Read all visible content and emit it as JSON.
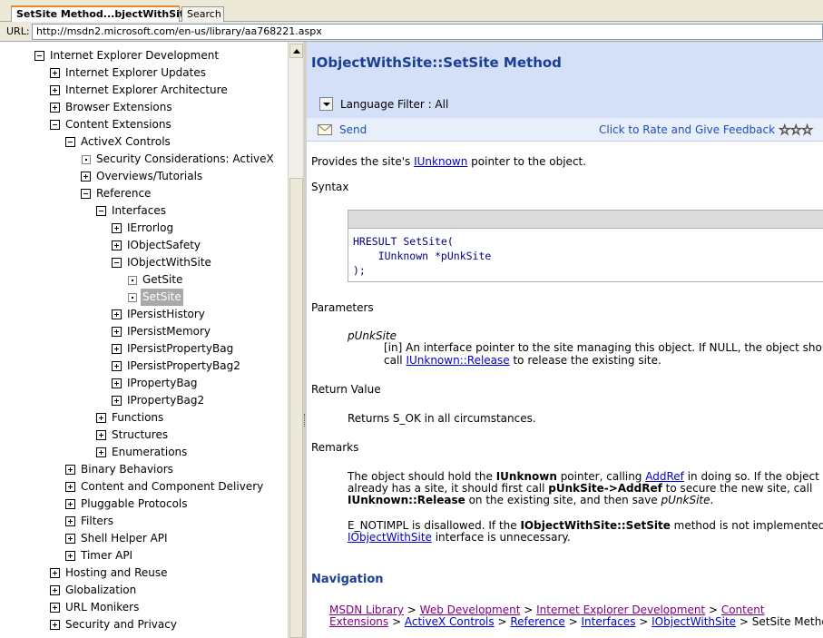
{
  "tabs": {
    "active": "SetSite Method...bjectWithSite)",
    "search": "Search"
  },
  "url": {
    "label": "URL:",
    "value": "http://msdn2.microsoft.com/en-us/library/aa768221.aspx"
  },
  "toc": {
    "ied": "Internet Explorer Development",
    "updates": "Internet Explorer Updates",
    "architecture": "Internet Explorer Architecture",
    "browser_ext": "Browser Extensions",
    "content_ext": "Content Extensions",
    "activex": "ActiveX Controls",
    "security_activex": "Security Considerations: ActiveX",
    "overviews": "Overviews/Tutorials",
    "reference": "Reference",
    "interfaces": "Interfaces",
    "ierrorlog": "IErrorlog",
    "iobjectsafety": "IObjectSafety",
    "iobjectwithsite": "IObjectWithSite",
    "getsite": "GetSite",
    "setsite": "SetSite",
    "ipersisthistory": "IPersistHistory",
    "ipersistmemory": "IPersistMemory",
    "ipersistpropertybag": "IPersistPropertyBag",
    "ipersistpropertybag2": "IPersistPropertyBag2",
    "ipropertybag": "IPropertyBag",
    "ipropertybag2": "IPropertyBag2",
    "functions": "Functions",
    "structures": "Structures",
    "enumerations": "Enumerations",
    "binary_behaviors": "Binary Behaviors",
    "content_delivery": "Content and Component Delivery",
    "pluggable": "Pluggable Protocols",
    "filters": "Filters",
    "shell_helper": "Shell Helper API",
    "timer": "Timer API",
    "hosting": "Hosting and Reuse",
    "globalization": "Globalization",
    "url_monikers": "URL Monikers",
    "security_privacy": "Security and Privacy"
  },
  "page": {
    "title": "IObjectWithSite::SetSite Method",
    "language_filter": "Language Filter : All",
    "send": "Send",
    "rate": "Click to Rate and Give Feedback",
    "stars": "☆☆☆",
    "intro_pre": "Provides the site's ",
    "intro_link": "IUnknown",
    "intro_post": " pointer to the object.",
    "syntax_heading": "Syntax",
    "code": "HRESULT SetSite(\n    IUnknown *pUnkSite\n);",
    "parameters_heading": "Parameters",
    "param_name": "pUnkSite",
    "param_line1": "[in] An interface pointer to the site managing this object. If NULL, the object should",
    "param_line2_pre": "call ",
    "param_line2_link": "IUnknown::Release",
    "param_line2_post": " to release the existing site.",
    "return_heading": "Return Value",
    "return_text": "Returns S_OK in all circumstances.",
    "remarks_heading": "Remarks",
    "r1_a": "The object should hold the ",
    "r1_b": "IUnknown",
    "r1_c": " pointer, calling ",
    "r1_link": "AddRef",
    "r1_d": " in doing so. If the object",
    "r2_a": "already has a site, it should first call ",
    "r2_b": "pUnkSite->AddRef",
    "r2_c": " to secure the new site, call",
    "r3_a": "IUnknown::Release",
    "r3_b": " on the existing site, and then save ",
    "r3_c": "pUnkSite",
    "r3_d": ".",
    "r4_a": "E_NOTIMPL is disallowed. If the ",
    "r4_b": "IObjectWithSite::SetSite",
    "r4_c": " method is not implemented, the",
    "r5_link": "IObjectWithSite",
    "r5_b": " interface is unnecessary.",
    "nav_heading": "Navigation",
    "bc_msdn": "MSDN Library",
    "bc_webdev": "Web Development",
    "bc_ied": "Internet Explorer Development",
    "bc_content1": "Content",
    "bc_content2": "Extensions",
    "bc_activex": "ActiveX Controls",
    "bc_reference": "Reference",
    "bc_interfaces": "Interfaces",
    "bc_iows": "IObjectWithSite",
    "bc_sep": " > ",
    "bc_current": "SetSite Method"
  }
}
